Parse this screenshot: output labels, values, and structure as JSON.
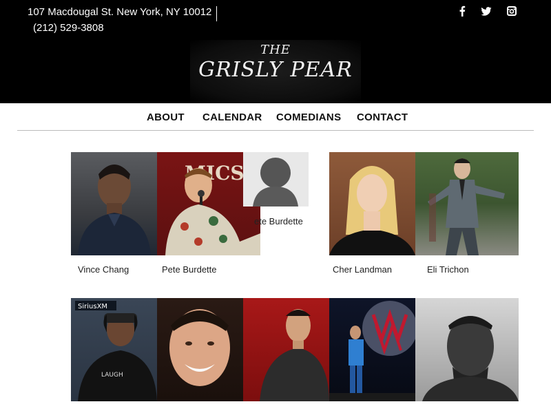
{
  "header": {
    "address": "107 Macdougal St. New York, NY 10012",
    "phone": "(212) 529-3808",
    "social": [
      "facebook-icon",
      "twitter-icon",
      "instagram-icon"
    ],
    "logo_the": "THE",
    "logo_main": "GRISLY PEAR"
  },
  "nav": {
    "items": [
      "ABOUT",
      "CALENDAR",
      "COMEDIANS",
      "CONTACT"
    ]
  },
  "comedians": {
    "row1": [
      {
        "name": "Vince Chang"
      },
      {
        "name": "Pete Burdette"
      },
      {
        "name": "Pete Burdette"
      },
      {
        "name": "Cher Landman"
      },
      {
        "name": "Eli Trichon"
      }
    ],
    "row1_overlay_text": "ete Burdette"
  },
  "colors": {
    "header_bg": "#000000",
    "nav_text": "#111111",
    "rule": "#bbbbbb"
  }
}
